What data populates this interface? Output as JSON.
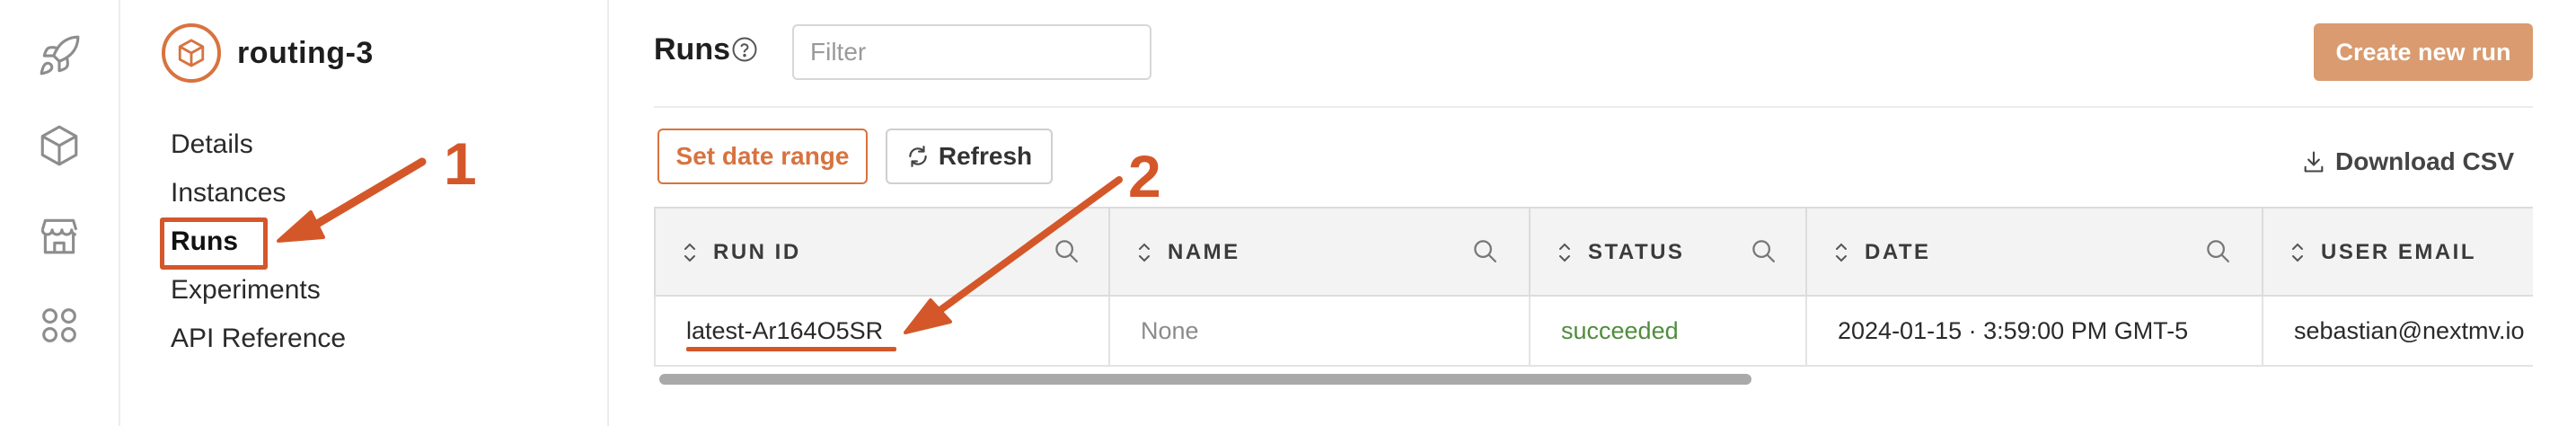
{
  "rail": {
    "icons": [
      "rocket-icon",
      "cube-icon",
      "marketplace-icon",
      "apps-grid-icon"
    ]
  },
  "sidebar": {
    "app_name": "routing-3",
    "nav": [
      {
        "label": "Details"
      },
      {
        "label": "Instances"
      },
      {
        "label": "Runs"
      },
      {
        "label": "Experiments"
      },
      {
        "label": "API Reference"
      }
    ]
  },
  "main": {
    "title": "Runs",
    "filter": {
      "placeholder": "Filter",
      "value": ""
    },
    "create_button": "Create new run",
    "date_range_button": "Set date range",
    "refresh_button": "Refresh",
    "download_button": "Download CSV"
  },
  "table": {
    "columns": [
      "RUN ID",
      "NAME",
      "STATUS",
      "DATE",
      "USER EMAIL"
    ],
    "rows": [
      {
        "run_id": "latest-Ar164O5SR",
        "name": "None",
        "status": "succeeded",
        "date": "2024-01-15 · 3:59:00 PM GMT-5",
        "user_email": "sebastian@nextmv.io"
      }
    ]
  },
  "annotations": {
    "step1": "1",
    "step2": "2"
  },
  "colors": {
    "accent": "#d8733f",
    "annotation": "#d4572a",
    "success": "#4f8d3c",
    "create_button_bg": "#d99b6f"
  }
}
